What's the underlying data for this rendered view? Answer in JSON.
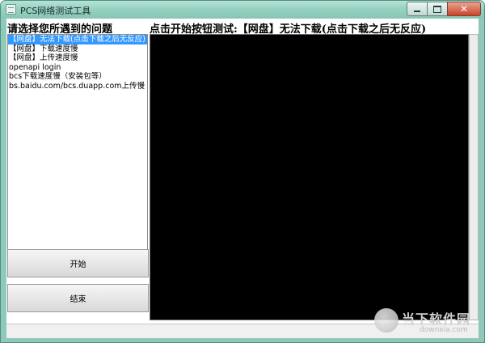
{
  "window": {
    "title": "PCS网络测试工具",
    "close_glyph": "✕"
  },
  "left_panel": {
    "heading": "请选择您所遇到的问题",
    "items": [
      {
        "label": "【网盘】无法下载(点击下载之后无反应)",
        "selected": true
      },
      {
        "label": "【网盘】下载速度慢",
        "selected": false
      },
      {
        "label": "【网盘】上传速度慢",
        "selected": false
      },
      {
        "label": "openapi login",
        "selected": false
      },
      {
        "label": "bcs下载速度慢（安装包等）",
        "selected": false
      },
      {
        "label": "bs.baidu.com/bcs.duapp.com上传慢",
        "selected": false
      }
    ],
    "start_button": "开始",
    "stop_button": "结束"
  },
  "right_panel": {
    "heading": "点击开始按钮测试:【网盘】无法下载(点击下载之后无反应)"
  },
  "watermark": {
    "title": "当下软件园",
    "url": "downxia.com"
  },
  "colors": {
    "titlebar": "#97d1c2",
    "selection": "#3399ff",
    "console_bg": "#000000",
    "close_button": "#c9452b"
  },
  "icons": [
    "app-icon",
    "minimize-icon",
    "maximize-icon",
    "close-icon",
    "downxia-logo-icon"
  ]
}
